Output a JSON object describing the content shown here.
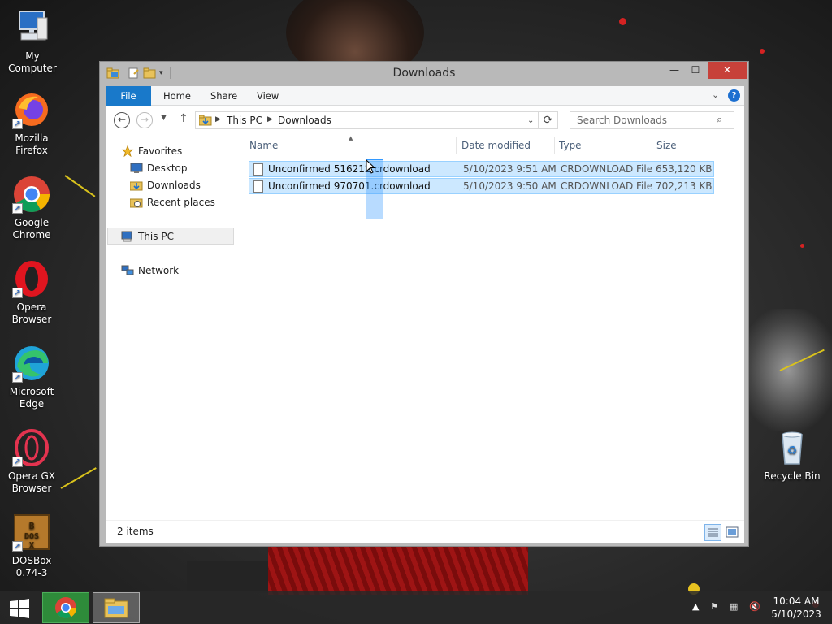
{
  "desktop": {
    "icons": [
      {
        "label": "My Computer"
      },
      {
        "label": "Mozilla Firefox"
      },
      {
        "label": "Google Chrome"
      },
      {
        "label": "Opera Browser"
      },
      {
        "label": "Microsoft Edge"
      },
      {
        "label": "Opera GX Browser"
      },
      {
        "label": "DOSBox 0.74-3"
      },
      {
        "label": "Recycle Bin"
      }
    ]
  },
  "window": {
    "title": "Downloads",
    "ribbon": {
      "tabs": [
        "File",
        "Home",
        "Share",
        "View"
      ]
    },
    "address": {
      "crumbs": [
        "This PC",
        "Downloads"
      ],
      "search_placeholder": "Search Downloads"
    },
    "nav_pane": {
      "favorites": "Favorites",
      "desktop": "Desktop",
      "downloads": "Downloads",
      "recent": "Recent places",
      "this_pc": "This PC",
      "network": "Network"
    },
    "columns": [
      "Name",
      "Date modified",
      "Type",
      "Size"
    ],
    "files": [
      {
        "name": "Unconfirmed 516212.crdownload",
        "date": "5/10/2023 9:51 AM",
        "type": "CRDOWNLOAD File",
        "size": "653,120 KB"
      },
      {
        "name": "Unconfirmed 970701.crdownload",
        "date": "5/10/2023 9:50 AM",
        "type": "CRDOWNLOAD File",
        "size": "702,213 KB"
      }
    ],
    "status": "2 items"
  },
  "taskbar": {
    "time": "10:04 AM",
    "date": "5/10/2023"
  },
  "colors": {
    "accent": "#1979ca",
    "selection": "#cce8ff",
    "close": "#c7413a"
  }
}
